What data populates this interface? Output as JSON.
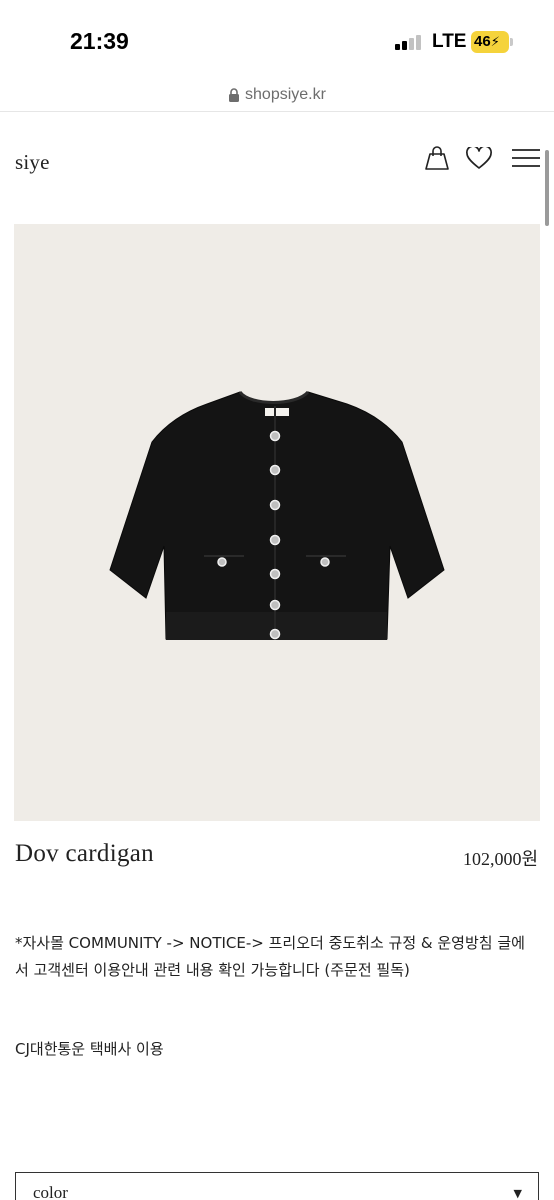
{
  "status_bar": {
    "time": "21:39",
    "network": "LTE",
    "battery": "46",
    "icons": [
      "signal-icon",
      "battery-icon"
    ]
  },
  "browser": {
    "url": "shopsiye.kr",
    "icons": [
      "lock-icon"
    ]
  },
  "header": {
    "logo": "siye",
    "icons": [
      "shopping-bag-icon",
      "heart-icon",
      "menu-icon"
    ]
  },
  "product": {
    "name": "Dov cardigan",
    "price": "102,000원",
    "image_desc_icon": "cardigan-image"
  },
  "notice": {
    "text": "*자사몰  COMMUNITY -> NOTICE->  프리오더 중도취소 규정 & 운영방침 글에서 고객센터 이용안내 관련 내용 확인 가능합니다 (주문전 필독)",
    "courier": "CJ대한통운 택배사 이용"
  },
  "option_select": {
    "label": "color",
    "arrow": "▼"
  },
  "colors": {
    "battery": "#f5d33b",
    "image_bg": "#efece7",
    "garment": "#141414"
  }
}
